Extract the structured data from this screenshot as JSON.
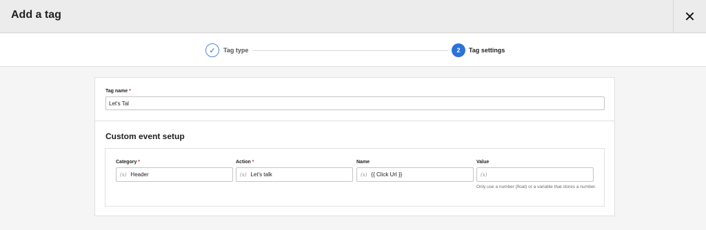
{
  "header": {
    "title": "Add a tag",
    "close_icon": "close-icon",
    "close_glyph": "✕"
  },
  "stepper": {
    "steps": [
      {
        "label": "Tag type",
        "state": "done",
        "icon": "check-icon",
        "glyph": "✓"
      },
      {
        "label": "Tag settings",
        "state": "active",
        "number": "2"
      }
    ],
    "active_color": "#2d72d9"
  },
  "tag_name": {
    "label": "Tag name",
    "required_mark": "*",
    "value": "Let's Tal"
  },
  "custom_event": {
    "title": "Custom event setup",
    "variable_icon_text": "(x)",
    "fields": [
      {
        "label": "Category",
        "required_mark": "*",
        "value": "Header"
      },
      {
        "label": "Action",
        "required_mark": "*",
        "value": "Let's talk"
      },
      {
        "label": "Name",
        "value": "{{ Click Url }}"
      },
      {
        "label": "Value",
        "value": "",
        "helper": "Only use a number (float) or a variable that stores a number."
      }
    ]
  }
}
